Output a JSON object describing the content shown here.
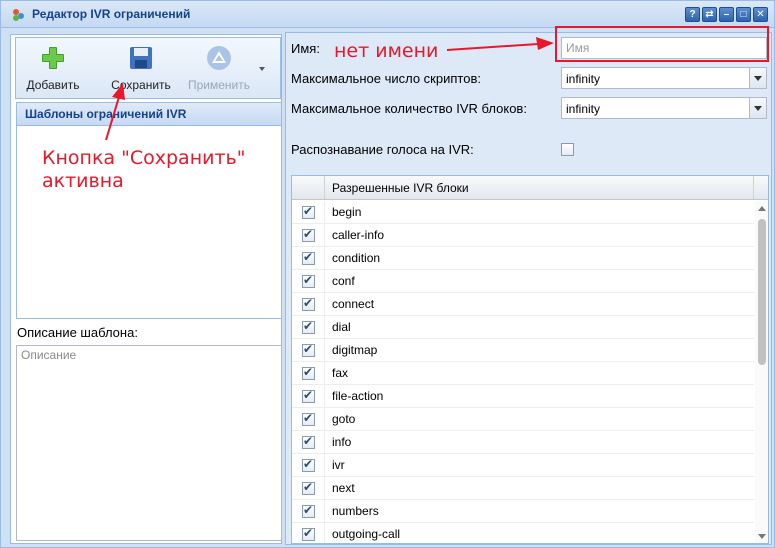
{
  "window": {
    "title": "Редактор IVR ограничений",
    "tools": [
      "help-icon",
      "swap-icon",
      "minimize-icon",
      "maximize-icon",
      "close-icon"
    ]
  },
  "toolbar": {
    "add_label": "Добавить",
    "save_label": "Сохранить",
    "apply_label": "Применить"
  },
  "templates": {
    "header": "Шаблоны ограничений IVR"
  },
  "description": {
    "label": "Описание шаблона:",
    "placeholder": "Описание"
  },
  "form": {
    "name_label": "Имя:",
    "name_placeholder": "Имя",
    "max_scripts_label": "Максимальное число скриптов:",
    "max_scripts_value": "infinity",
    "max_blocks_label": "Максимальное количество IVR блоков:",
    "max_blocks_value": "infinity",
    "voice_recognition_label": "Распознавание голоса на IVR:",
    "voice_recognition_checked": false
  },
  "ivr_blocks": {
    "header": "Разрешенные IVR блоки",
    "items": [
      {
        "name": "begin",
        "checked": true
      },
      {
        "name": "caller-info",
        "checked": true
      },
      {
        "name": "condition",
        "checked": true
      },
      {
        "name": "conf",
        "checked": true
      },
      {
        "name": "connect",
        "checked": true
      },
      {
        "name": "dial",
        "checked": true
      },
      {
        "name": "digitmap",
        "checked": true
      },
      {
        "name": "fax",
        "checked": true
      },
      {
        "name": "file-action",
        "checked": true
      },
      {
        "name": "goto",
        "checked": true
      },
      {
        "name": "info",
        "checked": true
      },
      {
        "name": "ivr",
        "checked": true
      },
      {
        "name": "next",
        "checked": true
      },
      {
        "name": "numbers",
        "checked": true
      },
      {
        "name": "outgoing-call",
        "checked": true
      }
    ]
  },
  "annotations": {
    "no_name": "нет имени",
    "save_active_line1": "Кнопка \"Сохранить\"",
    "save_active_line2": "активна",
    "color": "#e8182a"
  }
}
